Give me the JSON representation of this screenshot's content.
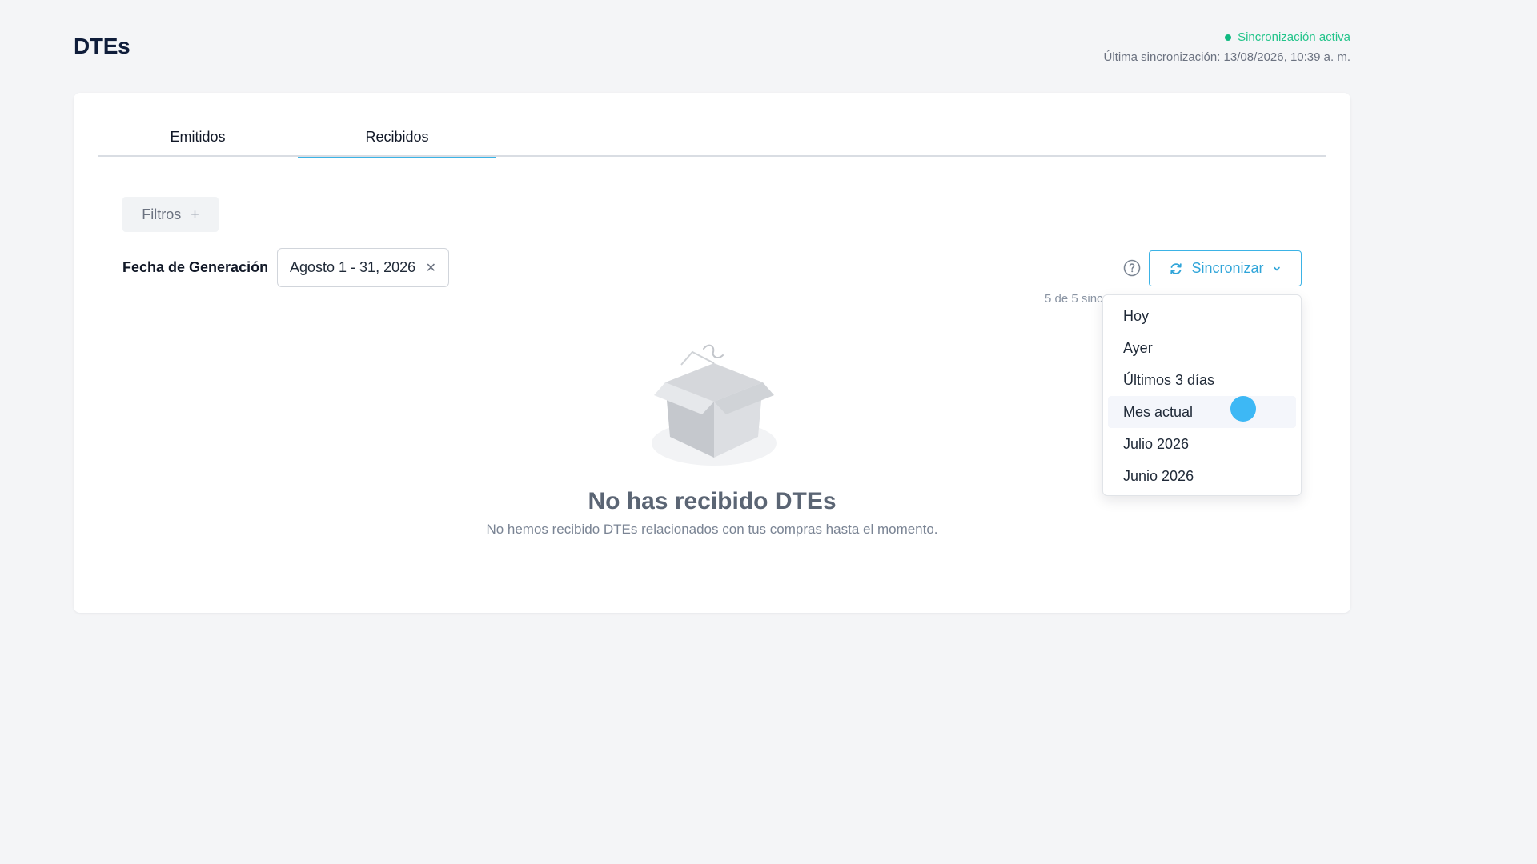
{
  "header": {
    "title": "DTEs",
    "sync_status": "Sincronización activa",
    "last_sync": "Última sincronización: 13/08/2026, 10:39 a. m."
  },
  "tabs": [
    {
      "label": "Emitidos",
      "active": false
    },
    {
      "label": "Recibidos",
      "active": true
    }
  ],
  "filters": {
    "button_label": "Filtros",
    "date_label": "Fecha de Generación",
    "date_value": "Agosto 1 - 31, 2026"
  },
  "sync_button": {
    "label": "Sincronizar"
  },
  "count_text": "5 de 5 sinc",
  "empty_state": {
    "title": "No has recibido DTEs",
    "subtitle": "No hemos recibido DTEs relacionados con tus compras hasta el momento."
  },
  "dropdown": {
    "items": [
      {
        "label": "Hoy"
      },
      {
        "label": "Ayer"
      },
      {
        "label": "Últimos 3 días"
      },
      {
        "label": "Mes actual"
      },
      {
        "label": "Julio 2026"
      },
      {
        "label": "Junio 2026"
      }
    ],
    "highlighted": "Mes actual"
  },
  "colors": {
    "accent": "#3bb3e6",
    "sync_active": "#22c48a",
    "background": "#f4f5f7"
  },
  "icons": {
    "help": "question-circle-icon",
    "sync": "refresh-icon",
    "dropdown": "chevron-down-icon",
    "clear": "close-icon",
    "add": "plus-icon",
    "empty": "empty-box-icon"
  }
}
